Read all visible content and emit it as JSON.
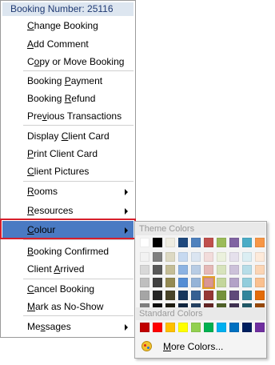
{
  "context_menu": {
    "header": "Booking Number: 25116",
    "items": [
      {
        "pre": "",
        "key": "C",
        "post": "hange Booking"
      },
      {
        "pre": "",
        "key": "A",
        "post": "dd Comment"
      },
      {
        "pre": "C",
        "key": "o",
        "post": "py or Move Booking"
      },
      {
        "pre": "Booking ",
        "key": "P",
        "post": "ayment"
      },
      {
        "pre": "Booking ",
        "key": "R",
        "post": "efund"
      },
      {
        "pre": "Pre",
        "key": "v",
        "post": "ious Transactions"
      },
      {
        "pre": "Display ",
        "key": "C",
        "post": "lient Card"
      },
      {
        "pre": "",
        "key": "P",
        "post": "rint Client Card"
      },
      {
        "pre": "",
        "key": "C",
        "post": "lient Pictures"
      },
      {
        "pre": "",
        "key": "R",
        "post": "ooms"
      },
      {
        "pre": "",
        "key": "R",
        "post": "esources"
      },
      {
        "pre": "",
        "key": "C",
        "post": "olour"
      },
      {
        "pre": "",
        "key": "B",
        "post": "ooking Confirmed"
      },
      {
        "pre": "Client ",
        "key": "A",
        "post": "rrived"
      },
      {
        "pre": "",
        "key": "C",
        "post": "ancel Booking"
      },
      {
        "pre": "",
        "key": "M",
        "post": "ark as No-Show"
      },
      {
        "pre": "Me",
        "key": "s",
        "post": "sages"
      }
    ]
  },
  "colour_submenu": {
    "theme_colors_label": "Theme Colors",
    "standard_colors_label": "Standard Colors",
    "more_colors_pre": "",
    "more_colors_key": "M",
    "more_colors_post": "ore Colors...",
    "theme_top": [
      "#ffffff",
      "#000000",
      "#eeece1",
      "#1f497d",
      "#4f81bd",
      "#c0504d",
      "#9bbb59",
      "#8064a2",
      "#4bacc6",
      "#f79646"
    ],
    "theme_shades": [
      [
        "#f2f2f2",
        "#7f7f7f",
        "#ddd9c3",
        "#c6d9f0",
        "#dbe5f1",
        "#f2dcdb",
        "#ebf1dd",
        "#e5e0ec",
        "#dbeef3",
        "#fdeada"
      ],
      [
        "#d8d8d8",
        "#595959",
        "#c4bd97",
        "#8db3e2",
        "#b8cce4",
        "#e5b9b7",
        "#d7e3bc",
        "#ccc1d9",
        "#b7dde8",
        "#fbd5b5"
      ],
      [
        "#bfbfbf",
        "#3f3f3f",
        "#938953",
        "#548dd4",
        "#95b3d7",
        "#d99694",
        "#c3d69b",
        "#b2a2c7",
        "#92cddc",
        "#fac08f"
      ],
      [
        "#a5a5a5",
        "#262626",
        "#494429",
        "#17365d",
        "#366092",
        "#953734",
        "#76923c",
        "#5f497a",
        "#31859b",
        "#e36c09"
      ],
      [
        "#7f7f7f",
        "#0c0c0c",
        "#1d1b10",
        "#0f243e",
        "#244061",
        "#632423",
        "#4f6128",
        "#3f3151",
        "#205867",
        "#974806"
      ]
    ],
    "standard": [
      "#c00000",
      "#ff0000",
      "#ffc000",
      "#ffff00",
      "#92d050",
      "#00b050",
      "#00b0f0",
      "#0070c0",
      "#002060",
      "#7030a0"
    ]
  }
}
